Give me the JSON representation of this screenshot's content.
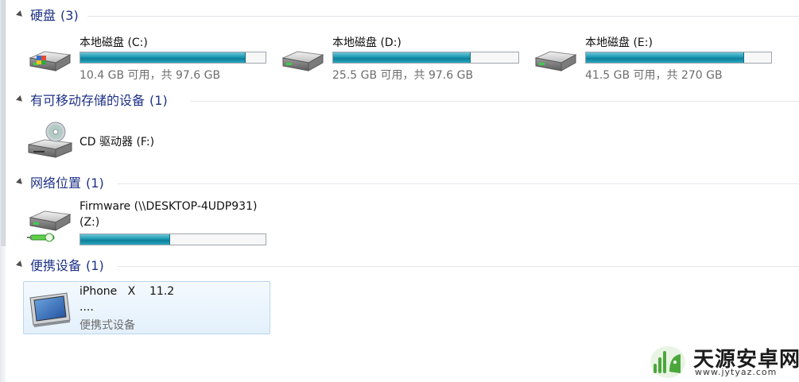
{
  "groups": {
    "hard_disks": {
      "title": "硬盘",
      "count": "(3)"
    },
    "removable": {
      "title": "有可移动存储的设备",
      "count": "(1)"
    },
    "network": {
      "title": "网络位置",
      "count": "(1)"
    },
    "portable": {
      "title": "便携设备",
      "count": "(1)"
    }
  },
  "drives": [
    {
      "name": "本地磁盘 (C:)",
      "space": "10.4 GB 可用，共 97.6 GB",
      "used_fraction": 0.89
    },
    {
      "name": "本地磁盘 (D:)",
      "space": "25.5 GB 可用，共 97.6 GB",
      "used_fraction": 0.74
    },
    {
      "name": "本地磁盘 (E:)",
      "space": "41.5 GB 可用，共 270 GB",
      "used_fraction": 0.85
    }
  ],
  "cd_drive": {
    "name": "CD 驱动器 (F:)"
  },
  "network_drive": {
    "name_line1": "Firmware (\\\\DESKTOP-4UDP931)",
    "name_line2": "(Z:)",
    "used_fraction": 0.48
  },
  "portable_device": {
    "name": "iPhone   X    11.2",
    "detail": "....",
    "type": "便携式设备"
  },
  "watermark": {
    "brand": "天源安卓网",
    "url": "www.jytyaz.com"
  },
  "colors": {
    "group_title": "#1e3287",
    "capacity_fill": "#26a0b8",
    "selection_border": "#b9d7f0"
  },
  "icons": {
    "hard_disk": "hard-disk-icon",
    "cd_drive": "cd-drive-icon",
    "network_drive": "network-drive-icon",
    "portable_device": "portable-device-icon"
  }
}
